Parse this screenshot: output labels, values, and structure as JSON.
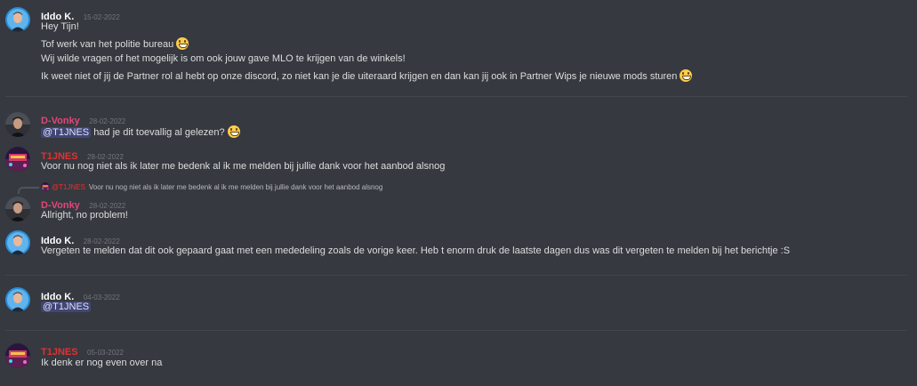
{
  "colors": {
    "background": "#36393f",
    "iddo_name": "#ffffff",
    "dvonky_name": "#e2467a",
    "tijnes_name": "#e23131",
    "mention_bg": "#414675",
    "timestamp": "#72767d"
  },
  "messages": [
    {
      "author": "Iddo K.",
      "timestamp": "15-02-2022",
      "lines": [
        "Hey Tijn!",
        "Tof werk van het politie bureau",
        "Wij wilde vragen of het mogelijk is om ook jouw gave MLO te krijgen van de winkels!",
        "Ik weet niet of jij de Partner rol al hebt op onze discord, zo niet kan je die uiteraard krijgen en dan kan jij ook in Partner Wips je nieuwe mods sturen"
      ]
    },
    {
      "author": "D-Vonky",
      "timestamp": "28-02-2022",
      "mention": "@T1JNES",
      "text": "had je dit toevallig al gelezen?"
    },
    {
      "author": "T1JNES",
      "timestamp": "28-02-2022",
      "text": "Voor nu nog niet als ik later me bedenk al ik me melden bij jullie dank voor het aanbod alsnog"
    },
    {
      "reply_author": "@T1JNES",
      "reply_text": "Voor nu nog niet als ik later me bedenk al ik me melden bij jullie dank voor het aanbod alsnog",
      "author": "D-Vonky",
      "timestamp": "28-02-2022",
      "text": "Allright, no problem!"
    },
    {
      "author": "Iddo K.",
      "timestamp": "28-02-2022",
      "text": "Vergeten te melden dat dit ook gepaard gaat met een mededeling zoals de vorige keer. Heb t enorm druk de laatste dagen dus was dit vergeten te melden bij het berichtje :S"
    },
    {
      "author": "Iddo K.",
      "timestamp": "04-03-2022",
      "mention": "@T1JNES"
    },
    {
      "author": "T1JNES",
      "timestamp": "05-03-2022",
      "text": "Ik denk er nog even over na"
    }
  ]
}
